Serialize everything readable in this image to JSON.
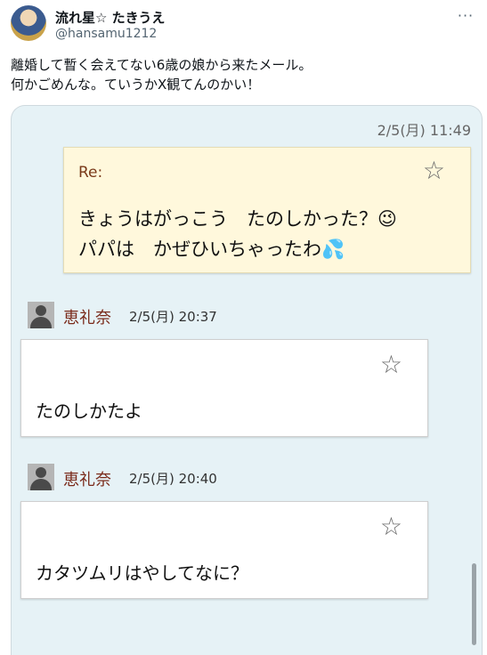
{
  "tweet": {
    "display_name": "流れ星☆ たきうえ",
    "handle": "@hansamu1212",
    "more_label": "···",
    "text_line1": "離婚して暫く会えてない6歳の娘から来たメール。",
    "text_line2": "何かごめんな。ていうかX観てんのかい！"
  },
  "mail": {
    "received_date": "2/5(月) 11:49",
    "original": {
      "subject": "Re:",
      "line1": "きょうはがっこう　たのしかった？😉",
      "line2": "パパは　かぜひいちゃったわ💦"
    },
    "replies": [
      {
        "sender": "恵礼奈",
        "time": "2/5(月) 20:37",
        "text": "たのしかたよ"
      },
      {
        "sender": "恵礼奈",
        "time": "2/5(月) 20:40",
        "text": "カタツムリはやしてなに？"
      }
    ]
  },
  "icons": {
    "star": "☆"
  }
}
